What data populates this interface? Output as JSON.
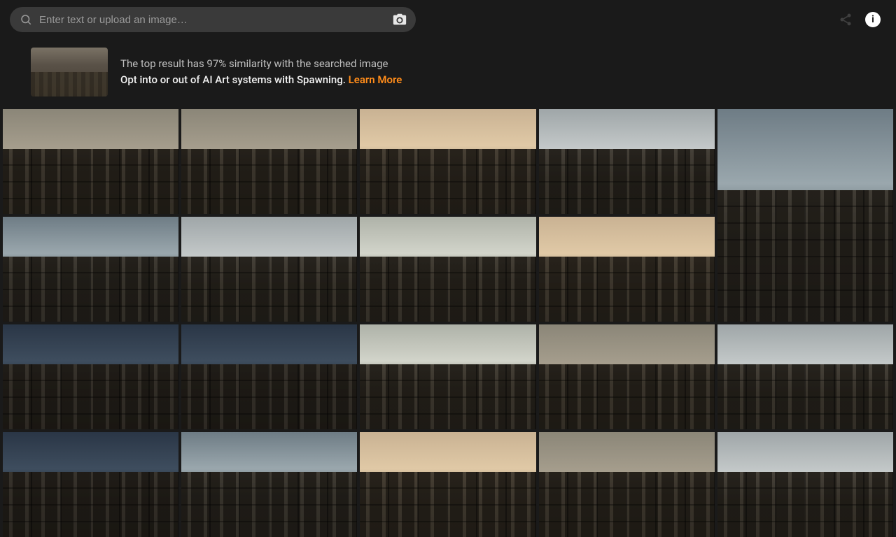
{
  "search": {
    "placeholder": "Enter text or upload an image…"
  },
  "banner": {
    "similarity_line": "The top result has 97% similarity with the searched image",
    "opt_line": "Opt into or out of AI Art systems with Spawning. ",
    "learn_more": "Learn More"
  },
  "icons": {
    "info_glyph": "i"
  }
}
